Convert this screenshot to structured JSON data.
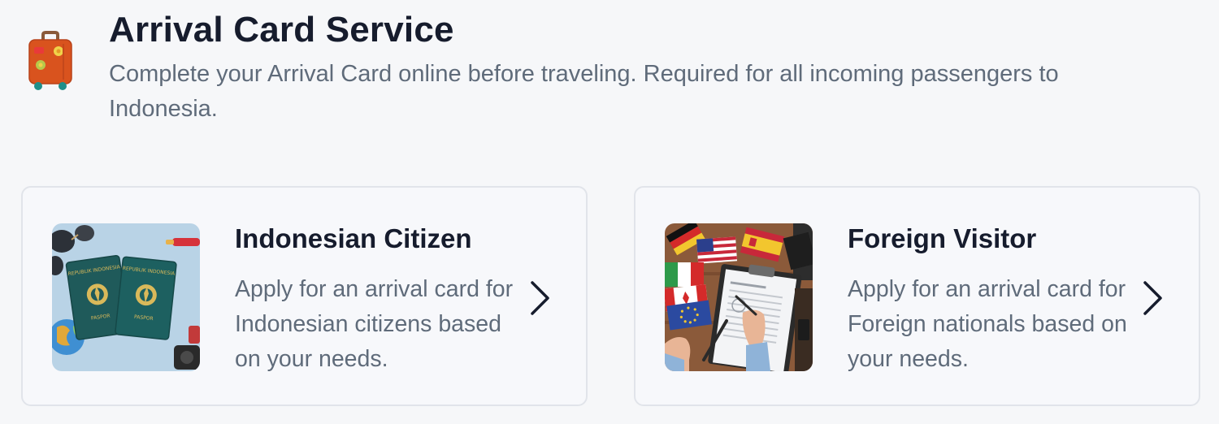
{
  "header": {
    "icon": "suitcase-icon",
    "title": "Arrival Card Service",
    "subtitle": "Complete your Arrival Card online before traveling. Required for all incoming passengers to Indonesia."
  },
  "cards": [
    {
      "title": "Indonesian Citizen",
      "description": "Apply for an arrival card for Indonesian citizens based on your needs.",
      "image": "indonesian-passports-image",
      "icon": "chevron-right-icon"
    },
    {
      "title": "Foreign Visitor",
      "description": "Apply for an arrival card for Foreign nationals based on your needs.",
      "image": "flags-and-form-image",
      "icon": "chevron-right-icon"
    }
  ],
  "colors": {
    "background": "#f6f7f9",
    "card_background": "#f7f8fb",
    "card_border": "#e1e4ea",
    "title_text": "#161c2d",
    "body_text": "#5f6b7a",
    "suitcase": "#d9531e"
  }
}
